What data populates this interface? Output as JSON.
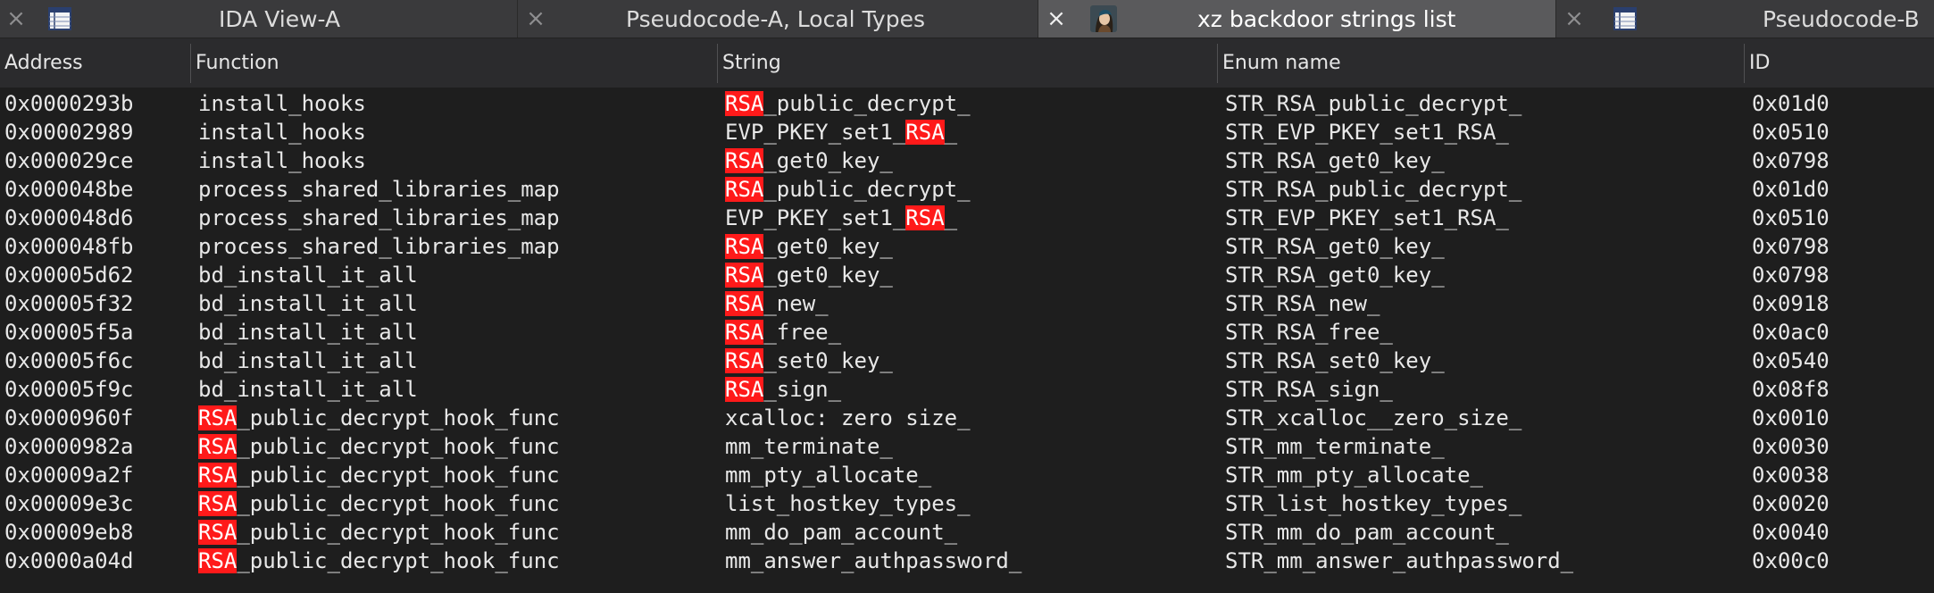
{
  "tabs": [
    {
      "label": "IDA View-A",
      "icon": "table-icon",
      "active": false
    },
    {
      "label": "Pseudocode-A, Local Types",
      "icon": null,
      "active": false
    },
    {
      "label": "xz backdoor strings list",
      "icon": "avatar-icon",
      "active": true
    },
    {
      "label": "Pseudocode-B",
      "icon": "table-icon",
      "active": false
    }
  ],
  "table": {
    "columns": [
      "Address",
      "Function",
      "String",
      "Enum name",
      "ID"
    ],
    "highlight_term": "RSA",
    "highlight_color": "#ff1a1a",
    "rows": [
      [
        "0x0000293b",
        "install_hooks",
        "RSA_public_decrypt_",
        "STR_RSA_public_decrypt_",
        "0x01d0"
      ],
      [
        "0x00002989",
        "install_hooks",
        "EVP_PKEY_set1_RSA_",
        "STR_EVP_PKEY_set1_RSA_",
        "0x0510"
      ],
      [
        "0x000029ce",
        "install_hooks",
        "RSA_get0_key_",
        "STR_RSA_get0_key_",
        "0x0798"
      ],
      [
        "0x000048be",
        "process_shared_libraries_map",
        "RSA_public_decrypt_",
        "STR_RSA_public_decrypt_",
        "0x01d0"
      ],
      [
        "0x000048d6",
        "process_shared_libraries_map",
        "EVP_PKEY_set1_RSA_",
        "STR_EVP_PKEY_set1_RSA_",
        "0x0510"
      ],
      [
        "0x000048fb",
        "process_shared_libraries_map",
        "RSA_get0_key_",
        "STR_RSA_get0_key_",
        "0x0798"
      ],
      [
        "0x00005d62",
        "bd_install_it_all",
        "RSA_get0_key_",
        "STR_RSA_get0_key_",
        "0x0798"
      ],
      [
        "0x00005f32",
        "bd_install_it_all",
        "RSA_new_",
        "STR_RSA_new_",
        "0x0918"
      ],
      [
        "0x00005f5a",
        "bd_install_it_all",
        "RSA_free_",
        "STR_RSA_free_",
        "0x0ac0"
      ],
      [
        "0x00005f6c",
        "bd_install_it_all",
        "RSA_set0_key_",
        "STR_RSA_set0_key_",
        "0x0540"
      ],
      [
        "0x00005f9c",
        "bd_install_it_all",
        "RSA_sign_",
        "STR_RSA_sign_",
        "0x08f8"
      ],
      [
        "0x0000960f",
        "RSA_public_decrypt_hook_func",
        "xcalloc: zero size_",
        "STR_xcalloc__zero_size_",
        "0x0010"
      ],
      [
        "0x0000982a",
        "RSA_public_decrypt_hook_func",
        "mm_terminate_",
        "STR_mm_terminate_",
        "0x0030"
      ],
      [
        "0x00009a2f",
        "RSA_public_decrypt_hook_func",
        "mm_pty_allocate_",
        "STR_mm_pty_allocate_",
        "0x0038"
      ],
      [
        "0x00009e3c",
        "RSA_public_decrypt_hook_func",
        "list_hostkey_types_",
        "STR_list_hostkey_types_",
        "0x0020"
      ],
      [
        "0x00009eb8",
        "RSA_public_decrypt_hook_func",
        "mm_do_pam_account_",
        "STR_mm_do_pam_account_",
        "0x0040"
      ],
      [
        "0x0000a04d",
        "RSA_public_decrypt_hook_func",
        "mm_answer_authpassword_",
        "STR_mm_answer_authpassword_",
        "0x00c0"
      ]
    ]
  }
}
